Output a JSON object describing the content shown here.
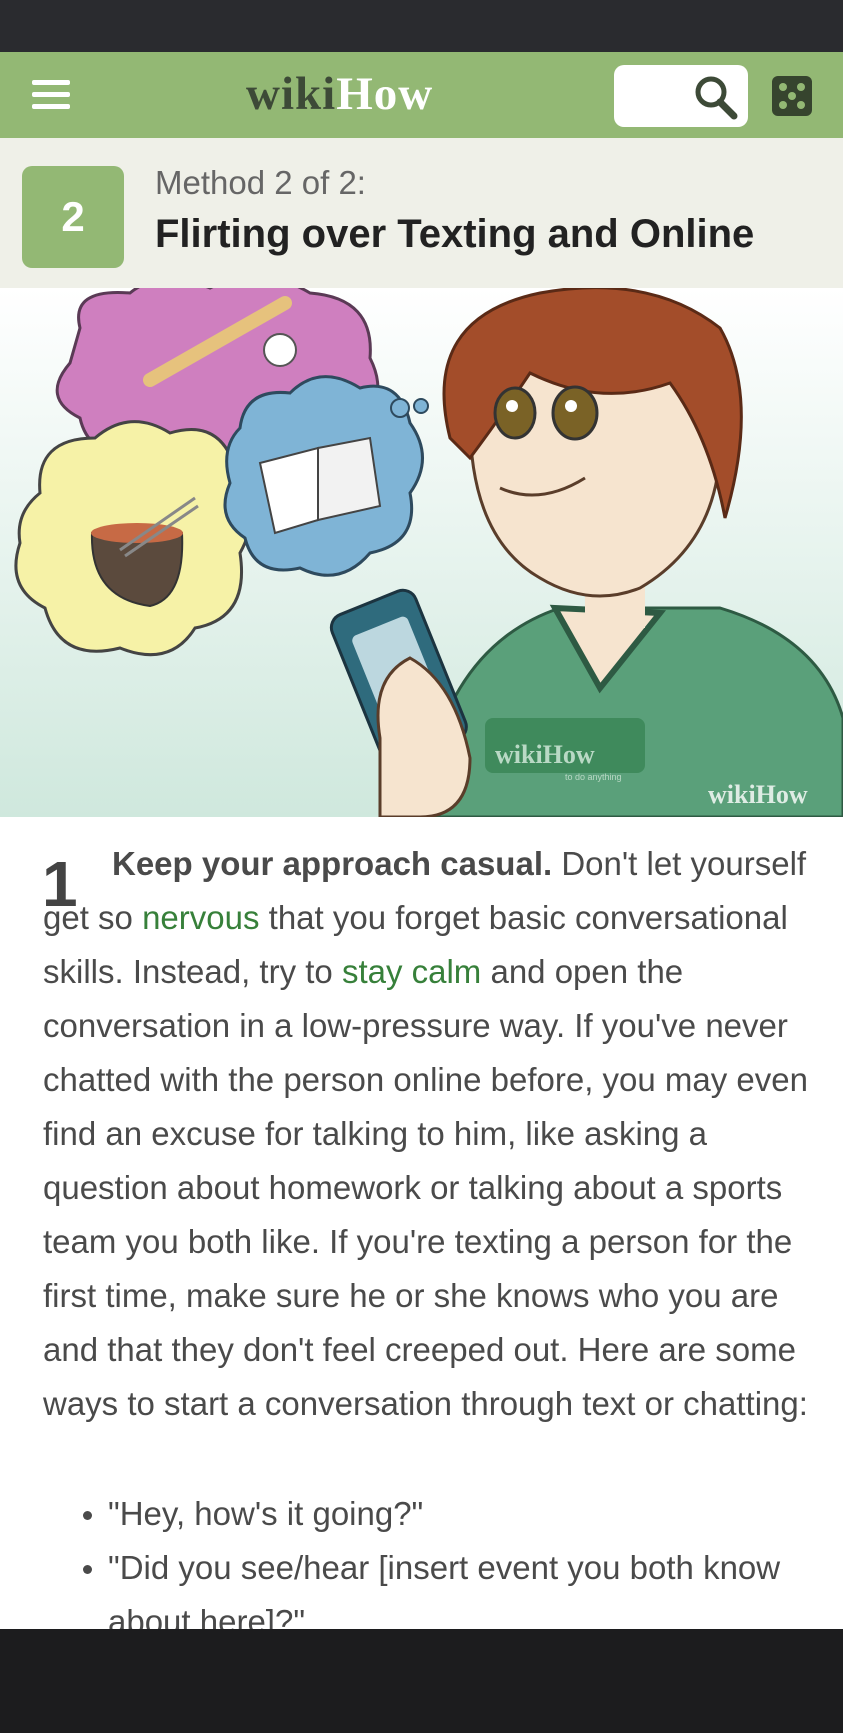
{
  "header": {
    "logo_part1": "wiki",
    "logo_part2": "How",
    "icons": [
      "menu-icon",
      "search-icon",
      "random-dice-icon"
    ]
  },
  "method": {
    "number": "2",
    "label": "Method 2 of 2:",
    "title": "Flirting over Texting and Online"
  },
  "illustration": {
    "shirt_logo": "wikiHow",
    "shirt_tagline": "to do anything",
    "watermark": "wikiHow"
  },
  "step": {
    "number": "1",
    "lead": "Keep your approach casual.",
    "text1": " Don't let yourself get so ",
    "link1": "nervous",
    "text2": " that you forget basic conversational skills. Instead, try to ",
    "link2": "stay calm",
    "text3": " and open the conversation in a low-pressure way. If you've never chatted with the person online before, you may even find an excuse for talking to him, like asking a question about homework or talking about a sports team you both like. If you're texting a person for the first time, make sure he or she knows who you are and that they don't feel creeped out. Here are some ways to start a conversation through text or chatting:",
    "bullets": [
      "\"Hey, how's it going?\"",
      "\"Did you see/hear [insert event you both know about here]?\""
    ]
  },
  "colors": {
    "brand_green": "#93b874",
    "dark_green": "#3d4a37",
    "link_green": "#37803a"
  }
}
